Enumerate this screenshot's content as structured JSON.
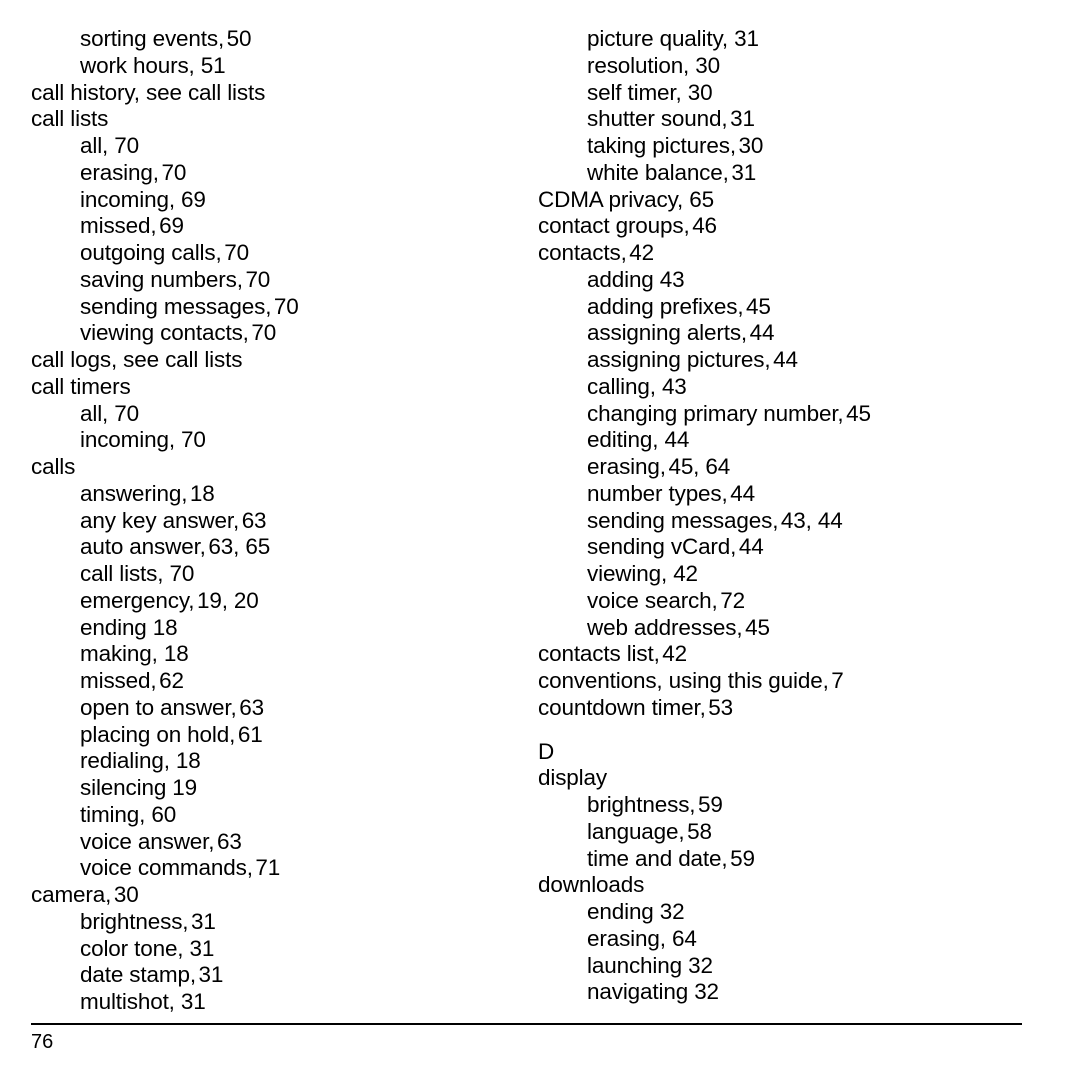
{
  "page": {
    "folio": "76",
    "columns": [
      {
        "name": "left",
        "blocks": [
          {
            "type": "entries",
            "items": [
              {
                "level": 2,
                "term": "sorting events,",
                "pages": "50",
                "tight": true
              },
              {
                "level": 2,
                "term": "work hours,",
                "pages": "51",
                "tight": false
              },
              {
                "level": 1,
                "term": "call history, see call lists",
                "pages": "",
                "tight": false
              },
              {
                "level": 1,
                "term": "call lists",
                "pages": "",
                "tight": false
              },
              {
                "level": 2,
                "term": "all,",
                "pages": "70",
                "tight": false
              },
              {
                "level": 2,
                "term": "erasing,",
                "pages": "70",
                "tight": true
              },
              {
                "level": 2,
                "term": "incoming,",
                "pages": "69",
                "tight": false
              },
              {
                "level": 2,
                "term": "missed,",
                "pages": "69",
                "tight": true
              },
              {
                "level": 2,
                "term": "outgoing calls,",
                "pages": "70",
                "tight": true
              },
              {
                "level": 2,
                "term": "saving numbers,",
                "pages": "70",
                "tight": true
              },
              {
                "level": 2,
                "term": "sending messages,",
                "pages": "70",
                "tight": true
              },
              {
                "level": 2,
                "term": "viewing contacts,",
                "pages": "70",
                "tight": true
              },
              {
                "level": 1,
                "term": "call logs, see call lists",
                "pages": "",
                "tight": false
              },
              {
                "level": 1,
                "term": "call timers",
                "pages": "",
                "tight": false
              },
              {
                "level": 2,
                "term": "all,",
                "pages": "70",
                "tight": false
              },
              {
                "level": 2,
                "term": "incoming,",
                "pages": "70",
                "tight": false
              },
              {
                "level": 1,
                "term": "calls",
                "pages": "",
                "tight": false
              },
              {
                "level": 2,
                "term": "answering,",
                "pages": "18",
                "tight": true
              },
              {
                "level": 2,
                "term": "any key answer,",
                "pages": "63",
                "tight": true
              },
              {
                "level": 2,
                "term": "auto answer,",
                "pages": "63, 65",
                "tight": true
              },
              {
                "level": 2,
                "term": "call lists,",
                "pages": "70",
                "tight": false
              },
              {
                "level": 2,
                "term": "emergency,",
                "pages": "19, 20",
                "tight": true
              },
              {
                "level": 2,
                "term": "ending",
                "pages": "18",
                "tight": false
              },
              {
                "level": 2,
                "term": "making,",
                "pages": "18",
                "tight": false
              },
              {
                "level": 2,
                "term": "missed,",
                "pages": "62",
                "tight": true
              },
              {
                "level": 2,
                "term": "open to answer,",
                "pages": "63",
                "tight": true
              },
              {
                "level": 2,
                "term": "placing on hold,",
                "pages": "61",
                "tight": true
              },
              {
                "level": 2,
                "term": "redialing,",
                "pages": "18",
                "tight": false
              },
              {
                "level": 2,
                "term": "silencing",
                "pages": "19",
                "tight": false
              },
              {
                "level": 2,
                "term": "timing,",
                "pages": "60",
                "tight": false
              },
              {
                "level": 2,
                "term": "voice answer,",
                "pages": "63",
                "tight": true
              },
              {
                "level": 2,
                "term": "voice commands,",
                "pages": "71",
                "tight": true
              },
              {
                "level": 1,
                "term": "camera,",
                "pages": "30",
                "tight": true
              },
              {
                "level": 2,
                "term": "brightness,",
                "pages": "31",
                "tight": true
              },
              {
                "level": 2,
                "term": "color tone,",
                "pages": "31",
                "tight": false
              },
              {
                "level": 2,
                "term": "date stamp,",
                "pages": "31",
                "tight": true
              },
              {
                "level": 2,
                "term": "multishot,",
                "pages": "31",
                "tight": false
              }
            ]
          }
        ]
      },
      {
        "name": "right",
        "blocks": [
          {
            "type": "entries",
            "items": [
              {
                "level": 2,
                "term": "picture quality,",
                "pages": "31",
                "tight": false
              },
              {
                "level": 2,
                "term": "resolution,",
                "pages": "30",
                "tight": false
              },
              {
                "level": 2,
                "term": "self timer,",
                "pages": "30",
                "tight": false
              },
              {
                "level": 2,
                "term": "shutter sound,",
                "pages": "31",
                "tight": true
              },
              {
                "level": 2,
                "term": "taking pictures,",
                "pages": "30",
                "tight": true
              },
              {
                "level": 2,
                "term": "white balance,",
                "pages": "31",
                "tight": true
              },
              {
                "level": 1,
                "term": "CDMA privacy,",
                "pages": "65",
                "tight": false
              },
              {
                "level": 1,
                "term": "contact groups,",
                "pages": "46",
                "tight": true
              },
              {
                "level": 1,
                "term": "contacts,",
                "pages": "42",
                "tight": true
              },
              {
                "level": 2,
                "term": "adding",
                "pages": "43",
                "tight": false
              },
              {
                "level": 2,
                "term": "adding prefixes,",
                "pages": "45",
                "tight": true
              },
              {
                "level": 2,
                "term": "assigning alerts,",
                "pages": "44",
                "tight": true
              },
              {
                "level": 2,
                "term": "assigning pictures,",
                "pages": "44",
                "tight": true
              },
              {
                "level": 2,
                "term": "calling,",
                "pages": "43",
                "tight": false
              },
              {
                "level": 2,
                "term": "changing primary number,",
                "pages": "45",
                "tight": true
              },
              {
                "level": 2,
                "term": "editing,",
                "pages": "44",
                "tight": false
              },
              {
                "level": 2,
                "term": "erasing,",
                "pages": "45, 64",
                "tight": true
              },
              {
                "level": 2,
                "term": "number types,",
                "pages": "44",
                "tight": true
              },
              {
                "level": 2,
                "term": "sending messages,",
                "pages": "43, 44",
                "tight": true
              },
              {
                "level": 2,
                "term": "sending vCard,",
                "pages": "44",
                "tight": true
              },
              {
                "level": 2,
                "term": "viewing,",
                "pages": "42",
                "tight": false
              },
              {
                "level": 2,
                "term": "voice search,",
                "pages": "72",
                "tight": true
              },
              {
                "level": 2,
                "term": "web addresses,",
                "pages": "45",
                "tight": true
              },
              {
                "level": 1,
                "term": "contacts list,",
                "pages": "42",
                "tight": true
              },
              {
                "level": 1,
                "term": "conventions, using this guide,",
                "pages": "7",
                "tight": true
              },
              {
                "level": 1,
                "term": "countdown timer,",
                "pages": "53",
                "tight": true
              }
            ]
          },
          {
            "type": "heading",
            "label": "D"
          },
          {
            "type": "entries",
            "items": [
              {
                "level": 1,
                "term": "display",
                "pages": "",
                "tight": false
              },
              {
                "level": 2,
                "term": "brightness,",
                "pages": "59",
                "tight": true
              },
              {
                "level": 2,
                "term": "language,",
                "pages": "58",
                "tight": true
              },
              {
                "level": 2,
                "term": "time and date,",
                "pages": "59",
                "tight": true
              },
              {
                "level": 1,
                "term": "downloads",
                "pages": "",
                "tight": false
              },
              {
                "level": 2,
                "term": "ending",
                "pages": "32",
                "tight": false
              },
              {
                "level": 2,
                "term": "erasing,",
                "pages": "64",
                "tight": false
              },
              {
                "level": 2,
                "term": "launching",
                "pages": "32",
                "tight": false
              },
              {
                "level": 2,
                "term": "navigating",
                "pages": "32",
                "tight": false
              }
            ]
          }
        ]
      }
    ]
  }
}
